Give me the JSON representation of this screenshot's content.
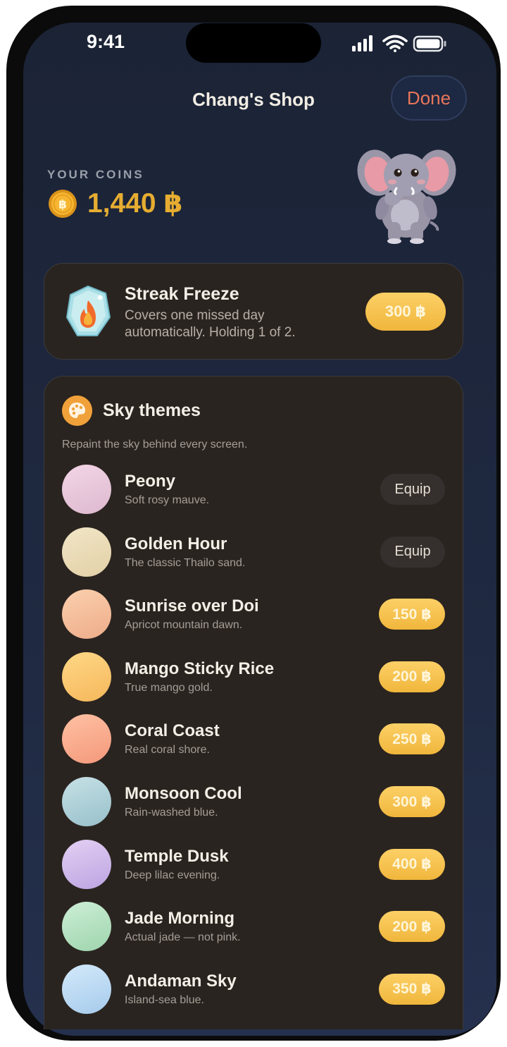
{
  "status_bar": {
    "time": "9:41"
  },
  "nav": {
    "title": "Chang's Shop",
    "done_label": "Done"
  },
  "coins": {
    "label": "YOUR COINS",
    "value": "1,440 ฿"
  },
  "streak_freeze": {
    "title": "Streak Freeze",
    "description": "Covers one missed day automatically. Holding 1 of 2.",
    "price": "300 ฿"
  },
  "sky_themes": {
    "title": "Sky themes",
    "subtitle": "Repaint the sky behind every screen.",
    "items": [
      {
        "name": "Peony",
        "description": "Soft rosy mauve.",
        "action": "Equip",
        "owned": true,
        "colors": [
          "#f3d5e6",
          "#ddb9cf"
        ]
      },
      {
        "name": "Golden Hour",
        "description": "The classic Thailo sand.",
        "action": "Equip",
        "owned": true,
        "colors": [
          "#f2e6c7",
          "#e2d0a6"
        ]
      },
      {
        "name": "Sunrise over Doi",
        "description": "Apricot mountain dawn.",
        "action": "150 ฿",
        "owned": false,
        "colors": [
          "#fbd0ad",
          "#eeac8a"
        ]
      },
      {
        "name": "Mango Sticky Rice",
        "description": "True mango gold.",
        "action": "200 ฿",
        "owned": false,
        "colors": [
          "#ffd886",
          "#f5b75b"
        ]
      },
      {
        "name": "Coral Coast",
        "description": "Real coral shore.",
        "action": "250 ฿",
        "owned": false,
        "colors": [
          "#ffc1a3",
          "#f4987b"
        ]
      },
      {
        "name": "Monsoon Cool",
        "description": "Rain-washed blue.",
        "action": "300 ฿",
        "owned": false,
        "colors": [
          "#c6e1e6",
          "#98c0ca"
        ]
      },
      {
        "name": "Temple Dusk",
        "description": "Deep lilac evening.",
        "action": "400 ฿",
        "owned": false,
        "colors": [
          "#e3d0f3",
          "#bca4e2"
        ]
      },
      {
        "name": "Jade Morning",
        "description": "Actual jade — not pink.",
        "action": "200 ฿",
        "owned": false,
        "colors": [
          "#cdefd6",
          "#9ed4ad"
        ]
      },
      {
        "name": "Andaman Sky",
        "description": "Island-sea blue.",
        "action": "350 ฿",
        "owned": false,
        "colors": [
          "#d3e9fa",
          "#a6cbec"
        ]
      }
    ]
  },
  "colors": {
    "accent_done": "#e8765a",
    "coin_gold": "#e6ad31",
    "price_button": "#f6c04c"
  },
  "icons": [
    "signal-icon",
    "wifi-icon",
    "battery-icon",
    "coin-icon",
    "elephant-mascot",
    "streak-freeze-icon",
    "palette-icon"
  ]
}
